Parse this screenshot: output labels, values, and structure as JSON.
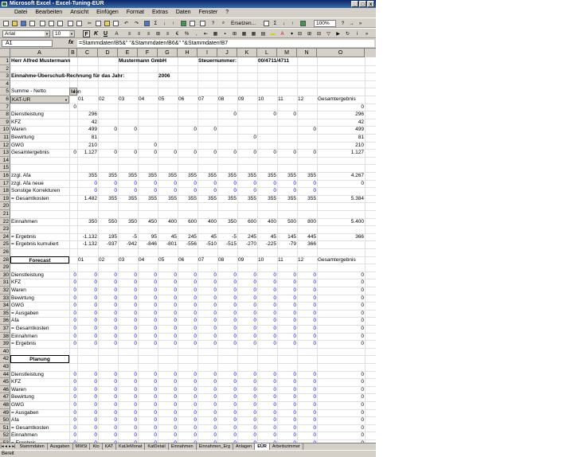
{
  "window": {
    "title": "Microsoft Excel - Excel-Tuning-EÜR",
    "minimize": "_",
    "maximize": "□",
    "close": "x"
  },
  "menu": [
    "Datei",
    "Bearbeiten",
    "Ansicht",
    "Einfügen",
    "Format",
    "Extras",
    "Daten",
    "Fenster",
    "?"
  ],
  "toolbar": {
    "font_name": "Arial",
    "font_size": "10",
    "bold": "F",
    "italic": "K",
    "underline": "U",
    "replace_label": "Ersetzen...",
    "zoom": "100%"
  },
  "formula_bar": {
    "name_box": "A1",
    "fx": "fx",
    "formula": "=Stammdaten!B5&\" \"&Stammdaten!B6&\" \"&Stammdaten!B7"
  },
  "columns": [
    "A",
    "B",
    "C",
    "D",
    "E",
    "F",
    "G",
    "H",
    "I",
    "J",
    "K",
    "L",
    "M",
    "N",
    "O"
  ],
  "rows": [
    {
      "n": "1",
      "cells": [
        {
          "c": "A",
          "t": "Herr Alfred Mustermann",
          "cls": "bold"
        },
        {
          "c": "E",
          "t": "Mustermann GmbH",
          "cls": "bold"
        },
        {
          "c": "I",
          "t": "Steuernummer:",
          "cls": "bold"
        },
        {
          "c": "L",
          "t": "00/4711/4711",
          "cls": "bold"
        }
      ]
    },
    {
      "n": "2",
      "cells": []
    },
    {
      "n": "3",
      "cells": [
        {
          "c": "A",
          "t": "Einnahme-Überschuß-Rechnung für das Jahr:",
          "cls": "bold"
        },
        {
          "c": "G",
          "t": "2006",
          "cls": "bold"
        }
      ]
    },
    {
      "n": "4",
      "cells": []
    },
    {
      "n": "5",
      "cells": [
        {
          "c": "A",
          "t": "Summe - Netto"
        },
        {
          "c": "B",
          "t": "Mon",
          "dd": true
        }
      ]
    },
    {
      "n": "6",
      "cells": [
        {
          "c": "A",
          "t": "KAT-UR",
          "dd": true
        },
        {
          "c": "C",
          "t": "01"
        },
        {
          "c": "D",
          "t": "02"
        },
        {
          "c": "E",
          "t": "03"
        },
        {
          "c": "F",
          "t": "04"
        },
        {
          "c": "G",
          "t": "05"
        },
        {
          "c": "H",
          "t": "06"
        },
        {
          "c": "I",
          "t": "07"
        },
        {
          "c": "J",
          "t": "08"
        },
        {
          "c": "K",
          "t": "09"
        },
        {
          "c": "L",
          "t": "10"
        },
        {
          "c": "M",
          "t": "11"
        },
        {
          "c": "N",
          "t": "12"
        },
        {
          "c": "O",
          "t": "Gesamtergebnis"
        }
      ]
    },
    {
      "n": "7",
      "cells": [
        {
          "c": "B",
          "t": "0",
          "r": 1
        },
        {
          "c": "O",
          "t": "0",
          "r": 1
        }
      ]
    },
    {
      "n": "8",
      "cells": [
        {
          "c": "A",
          "t": "Dienstleistung"
        },
        {
          "c": "C",
          "t": "296",
          "r": 1
        },
        {
          "c": "J",
          "t": "0",
          "r": 1
        },
        {
          "c": "L",
          "t": "0",
          "r": 1
        },
        {
          "c": "M",
          "t": "0",
          "r": 1
        },
        {
          "c": "O",
          "t": "296",
          "r": 1
        }
      ]
    },
    {
      "n": "9",
      "cells": [
        {
          "c": "A",
          "t": "KFZ"
        },
        {
          "c": "C",
          "t": "42",
          "r": 1
        },
        {
          "c": "O",
          "t": "42",
          "r": 1
        }
      ]
    },
    {
      "n": "10",
      "cells": [
        {
          "c": "A",
          "t": "Waren"
        },
        {
          "c": "C",
          "t": "499",
          "r": 1
        },
        {
          "c": "D",
          "t": "0",
          "r": 1
        },
        {
          "c": "E",
          "t": "0",
          "r": 1
        },
        {
          "c": "H",
          "t": "0",
          "r": 1
        },
        {
          "c": "I",
          "t": "0",
          "r": 1
        },
        {
          "c": "N",
          "t": "0",
          "r": 1
        },
        {
          "c": "O",
          "t": "499",
          "r": 1
        }
      ]
    },
    {
      "n": "11",
      "cells": [
        {
          "c": "A",
          "t": "Bewirtung"
        },
        {
          "c": "C",
          "t": "81",
          "r": 1
        },
        {
          "c": "K",
          "t": "0",
          "r": 1
        },
        {
          "c": "O",
          "t": "81",
          "r": 1
        }
      ]
    },
    {
      "n": "12",
      "cells": [
        {
          "c": "A",
          "t": "GWG"
        },
        {
          "c": "C",
          "t": "210",
          "r": 1
        },
        {
          "c": "F",
          "t": "0",
          "r": 1
        },
        {
          "c": "O",
          "t": "210",
          "r": 1
        }
      ]
    },
    {
      "n": "13",
      "cells": [
        {
          "c": "A",
          "t": "Gesamtergebnis"
        },
        {
          "c": "B",
          "t": "0",
          "r": 1
        },
        {
          "c": "C",
          "t": "1.127",
          "r": 1
        },
        {
          "c": "D",
          "t": "0",
          "r": 1
        },
        {
          "c": "E",
          "t": "0",
          "r": 1
        },
        {
          "c": "F",
          "t": "0",
          "r": 1
        },
        {
          "c": "G",
          "t": "0",
          "r": 1
        },
        {
          "c": "H",
          "t": "0",
          "r": 1
        },
        {
          "c": "I",
          "t": "0",
          "r": 1
        },
        {
          "c": "J",
          "t": "0",
          "r": 1
        },
        {
          "c": "K",
          "t": "0",
          "r": 1
        },
        {
          "c": "L",
          "t": "0",
          "r": 1
        },
        {
          "c": "M",
          "t": "0",
          "r": 1
        },
        {
          "c": "N",
          "t": "0",
          "r": 1
        },
        {
          "c": "O",
          "t": "1.127",
          "r": 1
        }
      ]
    },
    {
      "n": "14",
      "cells": []
    },
    {
      "n": "15",
      "cells": []
    },
    {
      "n": "16",
      "cells": [
        {
          "c": "A",
          "t": "zzgl. Afa"
        },
        {
          "c": "C",
          "t": "355",
          "r": 1
        },
        {
          "c": "D",
          "t": "355",
          "r": 1
        },
        {
          "c": "E",
          "t": "355",
          "r": 1
        },
        {
          "c": "F",
          "t": "355",
          "r": 1
        },
        {
          "c": "G",
          "t": "355",
          "r": 1
        },
        {
          "c": "H",
          "t": "355",
          "r": 1
        },
        {
          "c": "I",
          "t": "355",
          "r": 1
        },
        {
          "c": "J",
          "t": "355",
          "r": 1
        },
        {
          "c": "K",
          "t": "355",
          "r": 1
        },
        {
          "c": "L",
          "t": "355",
          "r": 1
        },
        {
          "c": "M",
          "t": "355",
          "r": 1
        },
        {
          "c": "N",
          "t": "355",
          "r": 1
        },
        {
          "c": "O",
          "t": "4.267",
          "r": 1
        }
      ]
    },
    {
      "n": "17",
      "cells": [
        {
          "c": "A",
          "t": "zzgl. Afa neue"
        },
        {
          "c": "C",
          "t": "0",
          "r": 1,
          "cls": "blue"
        },
        {
          "c": "D",
          "t": "0",
          "r": 1,
          "cls": "blue"
        },
        {
          "c": "E",
          "t": "0",
          "r": 1,
          "cls": "blue"
        },
        {
          "c": "F",
          "t": "0",
          "r": 1,
          "cls": "blue"
        },
        {
          "c": "G",
          "t": "0",
          "r": 1,
          "cls": "blue"
        },
        {
          "c": "H",
          "t": "0",
          "r": 1,
          "cls": "blue"
        },
        {
          "c": "I",
          "t": "0",
          "r": 1,
          "cls": "blue"
        },
        {
          "c": "J",
          "t": "0",
          "r": 1,
          "cls": "blue"
        },
        {
          "c": "K",
          "t": "0",
          "r": 1,
          "cls": "blue"
        },
        {
          "c": "L",
          "t": "0",
          "r": 1,
          "cls": "blue"
        },
        {
          "c": "M",
          "t": "0",
          "r": 1,
          "cls": "blue"
        },
        {
          "c": "N",
          "t": "0",
          "r": 1,
          "cls": "blue"
        },
        {
          "c": "O",
          "t": "0",
          "r": 1
        }
      ]
    },
    {
      "n": "18",
      "cells": [
        {
          "c": "A",
          "t": "Sonstige Korrekturen"
        },
        {
          "c": "C",
          "t": "0",
          "r": 1,
          "cls": "blue"
        },
        {
          "c": "D",
          "t": "0",
          "r": 1,
          "cls": "blue"
        },
        {
          "c": "E",
          "t": "0",
          "r": 1,
          "cls": "blue"
        },
        {
          "c": "F",
          "t": "0",
          "r": 1,
          "cls": "blue"
        },
        {
          "c": "G",
          "t": "0",
          "r": 1,
          "cls": "blue"
        },
        {
          "c": "H",
          "t": "0",
          "r": 1,
          "cls": "blue"
        },
        {
          "c": "I",
          "t": "0",
          "r": 1,
          "cls": "blue"
        },
        {
          "c": "J",
          "t": "0",
          "r": 1,
          "cls": "blue"
        },
        {
          "c": "K",
          "t": "0",
          "r": 1,
          "cls": "blue"
        },
        {
          "c": "L",
          "t": "0",
          "r": 1,
          "cls": "blue"
        },
        {
          "c": "M",
          "t": "0",
          "r": 1,
          "cls": "blue"
        },
        {
          "c": "N",
          "t": "0",
          "r": 1,
          "cls": "blue"
        }
      ]
    },
    {
      "n": "19",
      "cells": [
        {
          "c": "A",
          "t": "= Gesamtkosten"
        },
        {
          "c": "C",
          "t": "1.482",
          "r": 1
        },
        {
          "c": "D",
          "t": "355",
          "r": 1
        },
        {
          "c": "E",
          "t": "355",
          "r": 1
        },
        {
          "c": "F",
          "t": "355",
          "r": 1
        },
        {
          "c": "G",
          "t": "355",
          "r": 1
        },
        {
          "c": "H",
          "t": "355",
          "r": 1
        },
        {
          "c": "I",
          "t": "355",
          "r": 1
        },
        {
          "c": "J",
          "t": "355",
          "r": 1
        },
        {
          "c": "K",
          "t": "355",
          "r": 1
        },
        {
          "c": "L",
          "t": "355",
          "r": 1
        },
        {
          "c": "M",
          "t": "355",
          "r": 1
        },
        {
          "c": "N",
          "t": "355",
          "r": 1
        },
        {
          "c": "O",
          "t": "5.384",
          "r": 1
        }
      ]
    },
    {
      "n": "20",
      "cells": []
    },
    {
      "n": "21",
      "cells": []
    },
    {
      "n": "22",
      "cells": [
        {
          "c": "A",
          "t": "Einnahmen"
        },
        {
          "c": "C",
          "t": "350",
          "r": 1
        },
        {
          "c": "D",
          "t": "550",
          "r": 1
        },
        {
          "c": "E",
          "t": "350",
          "r": 1
        },
        {
          "c": "F",
          "t": "450",
          "r": 1
        },
        {
          "c": "G",
          "t": "400",
          "r": 1
        },
        {
          "c": "H",
          "t": "600",
          "r": 1
        },
        {
          "c": "I",
          "t": "400",
          "r": 1
        },
        {
          "c": "J",
          "t": "350",
          "r": 1
        },
        {
          "c": "K",
          "t": "600",
          "r": 1
        },
        {
          "c": "L",
          "t": "400",
          "r": 1
        },
        {
          "c": "M",
          "t": "500",
          "r": 1
        },
        {
          "c": "N",
          "t": "800",
          "r": 1
        },
        {
          "c": "O",
          "t": "5.400",
          "r": 1
        }
      ]
    },
    {
      "n": "23",
      "cells": []
    },
    {
      "n": "24",
      "cells": [
        {
          "c": "A",
          "t": "= Ergebnis"
        },
        {
          "c": "C",
          "t": "-1.132",
          "r": 1
        },
        {
          "c": "D",
          "t": "195",
          "r": 1
        },
        {
          "c": "E",
          "t": "-5",
          "r": 1
        },
        {
          "c": "F",
          "t": "95",
          "r": 1
        },
        {
          "c": "G",
          "t": "45",
          "r": 1
        },
        {
          "c": "H",
          "t": "245",
          "r": 1
        },
        {
          "c": "I",
          "t": "45",
          "r": 1
        },
        {
          "c": "J",
          "t": "-5",
          "r": 1
        },
        {
          "c": "K",
          "t": "245",
          "r": 1
        },
        {
          "c": "L",
          "t": "45",
          "r": 1
        },
        {
          "c": "M",
          "t": "145",
          "r": 1
        },
        {
          "c": "N",
          "t": "445",
          "r": 1
        },
        {
          "c": "O",
          "t": "366",
          "r": 1
        }
      ]
    },
    {
      "n": "25",
      "cells": [
        {
          "c": "A",
          "t": "= Ergebnis kumuliert"
        },
        {
          "c": "C",
          "t": "-1.132",
          "r": 1
        },
        {
          "c": "D",
          "t": "-937",
          "r": 1
        },
        {
          "c": "E",
          "t": "-942",
          "r": 1
        },
        {
          "c": "F",
          "t": "-846",
          "r": 1
        },
        {
          "c": "G",
          "t": "-801",
          "r": 1
        },
        {
          "c": "H",
          "t": "-556",
          "r": 1
        },
        {
          "c": "I",
          "t": "-510",
          "r": 1
        },
        {
          "c": "J",
          "t": "-515",
          "r": 1
        },
        {
          "c": "K",
          "t": "-270",
          "r": 1
        },
        {
          "c": "L",
          "t": "-225",
          "r": 1
        },
        {
          "c": "M",
          "t": "-79",
          "r": 1
        },
        {
          "c": "N",
          "t": "366",
          "r": 1
        }
      ]
    },
    {
      "n": "26",
      "cells": []
    },
    {
      "n": "28",
      "cells": [
        {
          "c": "A",
          "t": "Forecast",
          "cls": "bold",
          "btn": true
        },
        {
          "c": "C",
          "t": "01"
        },
        {
          "c": "D",
          "t": "02"
        },
        {
          "c": "E",
          "t": "03"
        },
        {
          "c": "F",
          "t": "04"
        },
        {
          "c": "G",
          "t": "05"
        },
        {
          "c": "H",
          "t": "06"
        },
        {
          "c": "I",
          "t": "07"
        },
        {
          "c": "J",
          "t": "08"
        },
        {
          "c": "K",
          "t": "09"
        },
        {
          "c": "L",
          "t": "10"
        },
        {
          "c": "M",
          "t": "11"
        },
        {
          "c": "N",
          "t": "12"
        },
        {
          "c": "O",
          "t": "Gesamtergebnis"
        }
      ]
    },
    {
      "n": "29",
      "cells": []
    },
    {
      "n": "30",
      "z": "Dienstleistung"
    },
    {
      "n": "31",
      "z": "KFZ"
    },
    {
      "n": "32",
      "z": "Waren"
    },
    {
      "n": "33",
      "z": "Bewirtung"
    },
    {
      "n": "34",
      "z": "GWG"
    },
    {
      "n": "35",
      "z": "= Ausgaben"
    },
    {
      "n": "36",
      "z": "Afa"
    },
    {
      "n": "37",
      "z": "= Gesamtkosten"
    },
    {
      "n": "38",
      "z": "Einnahmen"
    },
    {
      "n": "39",
      "z": "= Ergebnis"
    },
    {
      "n": "40",
      "cells": []
    },
    {
      "n": "42",
      "cells": [
        {
          "c": "A",
          "t": "Planung",
          "cls": "bold",
          "btn": true
        }
      ]
    },
    {
      "n": "43",
      "cells": []
    },
    {
      "n": "44",
      "z": "Dienstleistung"
    },
    {
      "n": "45",
      "z": "KFZ"
    },
    {
      "n": "46",
      "z": "Waren"
    },
    {
      "n": "47",
      "z": "Bewirtung"
    },
    {
      "n": "48",
      "z": "GWG"
    },
    {
      "n": "49",
      "z": "= Ausgaben"
    },
    {
      "n": "50",
      "z": "Afa"
    },
    {
      "n": "51",
      "z": "= Gesamtkosten"
    },
    {
      "n": "52",
      "z": "Einnahmen"
    },
    {
      "n": "53",
      "z": "= Ergebnis"
    }
  ],
  "sheet_tabs": [
    "Stammdaten",
    "Ausgaben",
    "MWSt",
    "Kto",
    "KAT",
    "KatJeMonat",
    "KatDetail",
    "Einnahmen",
    "Einnahmen_Erg",
    "Anlagen",
    "EÜR",
    "Arbeitszimmer"
  ],
  "active_sheet": "EÜR",
  "status": "Bereit"
}
